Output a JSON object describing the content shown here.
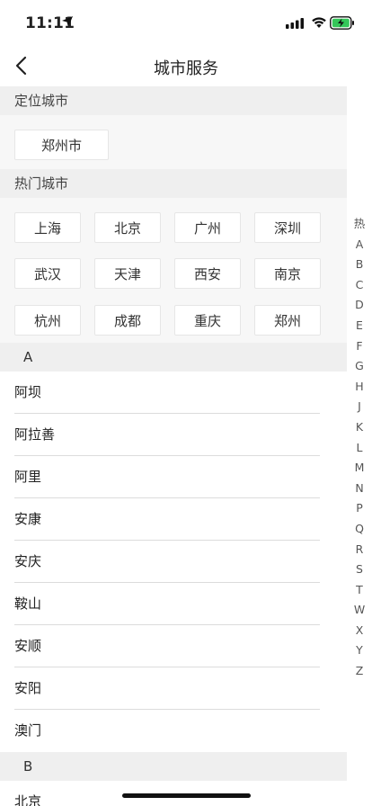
{
  "status_bar": {
    "time": "11:11"
  },
  "nav": {
    "title": "城市服务"
  },
  "location_section": {
    "header": "定位城市",
    "city": "郑州市"
  },
  "hot_section": {
    "header": "热门城市",
    "cities": [
      "上海",
      "北京",
      "广州",
      "深圳",
      "武汉",
      "天津",
      "西安",
      "南京",
      "杭州",
      "成都",
      "重庆",
      "郑州"
    ]
  },
  "groups": [
    {
      "letter": "A",
      "cities": [
        "阿坝",
        "阿拉善",
        "阿里",
        "安康",
        "安庆",
        "鞍山",
        "安顺",
        "安阳",
        "澳门"
      ]
    },
    {
      "letter": "B",
      "cities": [
        "北京"
      ]
    }
  ],
  "index_bar": [
    "热",
    "A",
    "B",
    "C",
    "D",
    "E",
    "F",
    "G",
    "H",
    "J",
    "K",
    "L",
    "M",
    "N",
    "P",
    "Q",
    "R",
    "S",
    "T",
    "W",
    "X",
    "Y",
    "Z"
  ],
  "colors": {
    "section_bg": "#efefef",
    "panel_bg": "#f7f7f7",
    "battery_charging": "#34c759"
  }
}
